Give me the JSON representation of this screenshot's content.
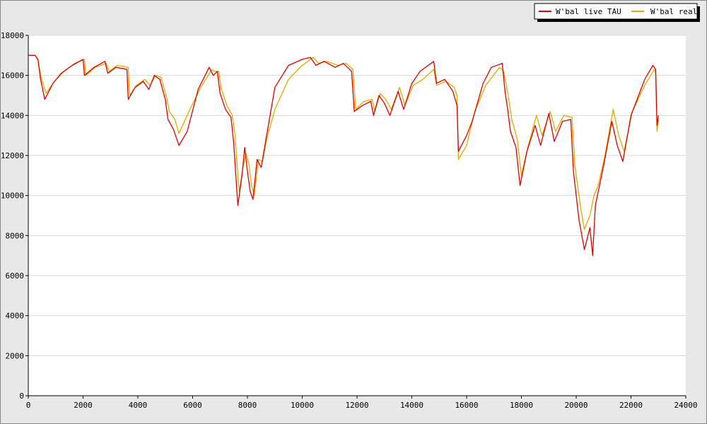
{
  "chart_data": {
    "type": "line",
    "title": "",
    "xlabel": "",
    "ylabel": "",
    "xlim": [
      0,
      24000
    ],
    "ylim": [
      0,
      18000
    ],
    "x_ticks": [
      0,
      2000,
      4000,
      6000,
      8000,
      10000,
      12000,
      14000,
      16000,
      18000,
      20000,
      22000,
      24000
    ],
    "y_ticks": [
      0,
      2000,
      4000,
      6000,
      8000,
      10000,
      12000,
      14000,
      16000,
      18000
    ],
    "grid": "horizontal",
    "legend_position": "top-right",
    "colors": {
      "background": "#e8e8e8",
      "plot_area": "#ffffff",
      "grid": "#d8d8d8"
    },
    "series": [
      {
        "name": "W'bal live TAU",
        "color": "#dd0000",
        "points": [
          [
            0,
            17000
          ],
          [
            250,
            17000
          ],
          [
            350,
            16800
          ],
          [
            450,
            15800
          ],
          [
            600,
            14800
          ],
          [
            900,
            15600
          ],
          [
            1200,
            16100
          ],
          [
            1600,
            16500
          ],
          [
            2000,
            16800
          ],
          [
            2050,
            16000
          ],
          [
            2400,
            16400
          ],
          [
            2800,
            16700
          ],
          [
            2900,
            16100
          ],
          [
            3200,
            16400
          ],
          [
            3600,
            16300
          ],
          [
            3650,
            14800
          ],
          [
            3900,
            15400
          ],
          [
            4200,
            15700
          ],
          [
            4400,
            15300
          ],
          [
            4600,
            16000
          ],
          [
            4800,
            15800
          ],
          [
            5000,
            14800
          ],
          [
            5100,
            13800
          ],
          [
            5300,
            13300
          ],
          [
            5500,
            12500
          ],
          [
            5800,
            13200
          ],
          [
            6200,
            15300
          ],
          [
            6600,
            16400
          ],
          [
            6750,
            16000
          ],
          [
            6900,
            16200
          ],
          [
            7000,
            15100
          ],
          [
            7200,
            14300
          ],
          [
            7400,
            13900
          ],
          [
            7500,
            12600
          ],
          [
            7600,
            10500
          ],
          [
            7650,
            9500
          ],
          [
            7800,
            11000
          ],
          [
            7900,
            12400
          ],
          [
            8000,
            11200
          ],
          [
            8100,
            10200
          ],
          [
            8200,
            9800
          ],
          [
            8350,
            11800
          ],
          [
            8500,
            11400
          ],
          [
            8700,
            13000
          ],
          [
            9000,
            15400
          ],
          [
            9500,
            16500
          ],
          [
            10000,
            16800
          ],
          [
            10300,
            16900
          ],
          [
            10500,
            16500
          ],
          [
            10800,
            16700
          ],
          [
            11200,
            16400
          ],
          [
            11500,
            16600
          ],
          [
            11800,
            16200
          ],
          [
            11900,
            14200
          ],
          [
            12200,
            14500
          ],
          [
            12500,
            14700
          ],
          [
            12600,
            14000
          ],
          [
            12800,
            15000
          ],
          [
            13000,
            14600
          ],
          [
            13200,
            14000
          ],
          [
            13500,
            15200
          ],
          [
            13700,
            14300
          ],
          [
            14000,
            15600
          ],
          [
            14300,
            16200
          ],
          [
            14800,
            16700
          ],
          [
            14900,
            15600
          ],
          [
            15200,
            15800
          ],
          [
            15500,
            15200
          ],
          [
            15650,
            14500
          ],
          [
            15700,
            12200
          ],
          [
            16000,
            13000
          ],
          [
            16200,
            13700
          ],
          [
            16600,
            15600
          ],
          [
            16900,
            16400
          ],
          [
            17300,
            16600
          ],
          [
            17400,
            15200
          ],
          [
            17500,
            14300
          ],
          [
            17600,
            13200
          ],
          [
            17800,
            12400
          ],
          [
            17950,
            10500
          ],
          [
            18200,
            12200
          ],
          [
            18500,
            13500
          ],
          [
            18700,
            12500
          ],
          [
            19000,
            14100
          ],
          [
            19200,
            12700
          ],
          [
            19500,
            13700
          ],
          [
            19800,
            13800
          ],
          [
            19900,
            11200
          ],
          [
            20100,
            8800
          ],
          [
            20300,
            7300
          ],
          [
            20500,
            8400
          ],
          [
            20600,
            7000
          ],
          [
            20700,
            9500
          ],
          [
            21000,
            11500
          ],
          [
            21300,
            13700
          ],
          [
            21500,
            12500
          ],
          [
            21700,
            11700
          ],
          [
            22000,
            14000
          ],
          [
            22500,
            15800
          ],
          [
            22800,
            16500
          ],
          [
            22900,
            16300
          ],
          [
            22950,
            13500
          ],
          [
            23000,
            14000
          ]
        ]
      },
      {
        "name": "W'bal real",
        "color": "#ddaa00",
        "points": [
          [
            0,
            17000
          ],
          [
            250,
            17000
          ],
          [
            350,
            16800
          ],
          [
            450,
            16000
          ],
          [
            650,
            15100
          ],
          [
            950,
            15700
          ],
          [
            1300,
            16200
          ],
          [
            1700,
            16600
          ],
          [
            2050,
            16800
          ],
          [
            2100,
            16000
          ],
          [
            2450,
            16400
          ],
          [
            2850,
            16600
          ],
          [
            2950,
            16200
          ],
          [
            3250,
            16500
          ],
          [
            3650,
            16400
          ],
          [
            3700,
            15000
          ],
          [
            3950,
            15500
          ],
          [
            4250,
            15800
          ],
          [
            4450,
            15500
          ],
          [
            4650,
            16000
          ],
          [
            4850,
            15900
          ],
          [
            5050,
            14900
          ],
          [
            5150,
            14200
          ],
          [
            5350,
            13800
          ],
          [
            5500,
            13100
          ],
          [
            5900,
            14300
          ],
          [
            6300,
            15400
          ],
          [
            6700,
            16300
          ],
          [
            6800,
            16200
          ],
          [
            6950,
            16200
          ],
          [
            7050,
            15300
          ],
          [
            7250,
            14500
          ],
          [
            7450,
            14000
          ],
          [
            7550,
            13000
          ],
          [
            7650,
            11000
          ],
          [
            7700,
            10200
          ],
          [
            7850,
            11500
          ],
          [
            7950,
            12100
          ],
          [
            8050,
            11600
          ],
          [
            8150,
            10500
          ],
          [
            8250,
            10000
          ],
          [
            8400,
            11800
          ],
          [
            8550,
            11700
          ],
          [
            8700,
            12800
          ],
          [
            9000,
            14300
          ],
          [
            9500,
            15800
          ],
          [
            10000,
            16500
          ],
          [
            10400,
            16900
          ],
          [
            10600,
            16600
          ],
          [
            10900,
            16700
          ],
          [
            11300,
            16500
          ],
          [
            11600,
            16600
          ],
          [
            11850,
            16300
          ],
          [
            11950,
            14300
          ],
          [
            12250,
            14700
          ],
          [
            12550,
            14800
          ],
          [
            12650,
            14200
          ],
          [
            12850,
            15100
          ],
          [
            13050,
            14800
          ],
          [
            13250,
            14300
          ],
          [
            13550,
            15400
          ],
          [
            13750,
            14500
          ],
          [
            14050,
            15500
          ],
          [
            14400,
            15800
          ],
          [
            14800,
            16300
          ],
          [
            14900,
            15500
          ],
          [
            15250,
            15700
          ],
          [
            15550,
            15400
          ],
          [
            15650,
            15000
          ],
          [
            15700,
            11800
          ],
          [
            16000,
            12500
          ],
          [
            16300,
            14200
          ],
          [
            16700,
            15500
          ],
          [
            17200,
            16400
          ],
          [
            17350,
            16200
          ],
          [
            17450,
            15500
          ],
          [
            17550,
            14700
          ],
          [
            17650,
            13800
          ],
          [
            17850,
            12800
          ],
          [
            18000,
            11000
          ],
          [
            18250,
            12500
          ],
          [
            18550,
            14000
          ],
          [
            18750,
            13000
          ],
          [
            19050,
            14200
          ],
          [
            19250,
            13200
          ],
          [
            19550,
            14000
          ],
          [
            19850,
            13900
          ],
          [
            19950,
            11500
          ],
          [
            20150,
            9500
          ],
          [
            20300,
            8300
          ],
          [
            20500,
            9000
          ],
          [
            20650,
            10000
          ],
          [
            20800,
            10500
          ],
          [
            21050,
            12000
          ],
          [
            21350,
            14300
          ],
          [
            21550,
            13000
          ],
          [
            21750,
            12200
          ],
          [
            22050,
            14200
          ],
          [
            22500,
            15500
          ],
          [
            22850,
            16300
          ],
          [
            22900,
            16100
          ],
          [
            22950,
            13200
          ],
          [
            23000,
            13800
          ]
        ]
      }
    ]
  }
}
